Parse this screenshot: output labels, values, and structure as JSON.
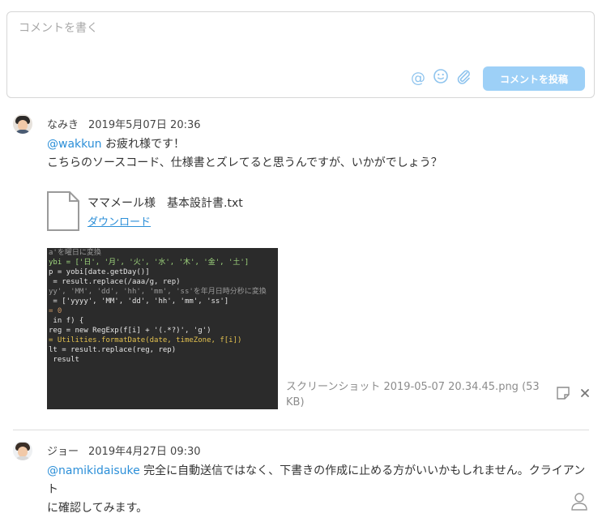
{
  "composer": {
    "placeholder": "コメントを書く",
    "post_button_label": "コメントを投稿",
    "tools": {
      "mention": "@",
      "emoji": "☺",
      "attach": "📎"
    }
  },
  "comments": [
    {
      "author": "なみき",
      "date": "2019年5月07日 20:36",
      "mention": "@wakkun",
      "line1": " お疲れ様です！",
      "line2": "こちらのソースコード、仕様書とズレてると思うんですが、いかがでしょう？",
      "file": {
        "name": "ママメール様　基本設計書.txt",
        "download": "ダウンロード"
      },
      "screenshot": {
        "name_line1": "スクリーンショット 2019-05-07 20.34.45.png (53",
        "name_line2": "KB)",
        "code": [
          "a'を曜日に変換",
          "ybi = ['日', '月', '火', '水', '木', '金', '土']",
          "p = yobi[date.getDay()]",
          " = result.replace(/aaa/g, rep)",
          "",
          "yy', 'MM', 'dd', 'hh', 'mm', 'ss'を年月日時分秒に変換",
          " = ['yyyy', 'MM', 'dd', 'hh', 'mm', 'ss']",
          "= 0",
          " in f) {",
          "reg = new RegExp(f[i] + '(.*?)', 'g')",
          "= Utilities.formatDate(date, timeZone, f[i])",
          "lt = result.replace(reg, rep)",
          "",
          " result"
        ]
      }
    },
    {
      "author": "ジョー",
      "date": "2019年4月27日 09:30",
      "mention": "@namikidaisuke",
      "line1": " 完全に自動送信ではなく、下書きの作成に止める方がいいかもしれません。クライアント",
      "line2": "に確認してみます。"
    }
  ],
  "colors": {
    "accent": "#2c8fd8",
    "button": "#9dd0f7",
    "icon_light": "#8fc4ee"
  }
}
